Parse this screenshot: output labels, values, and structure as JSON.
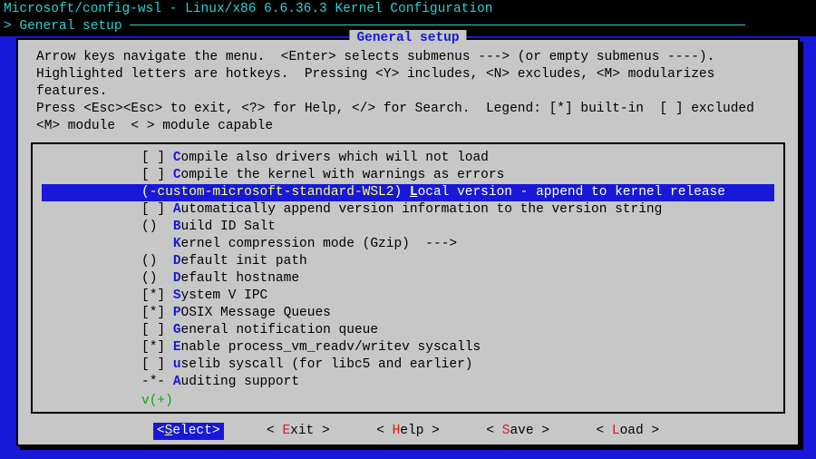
{
  "titlebar": "Microsoft/config-wsl - Linux/x86 6.6.36.3 Kernel Configuration",
  "breadcrumb": "> General setup ──────────────────────────────────────────────────────────────────────────────",
  "dialog_title": "General setup",
  "help": "Arrow keys navigate the menu.  <Enter> selects submenus ---> (or empty submenus ----).\nHighlighted letters are hotkeys.  Pressing <Y> includes, <N> excludes, <M> modularizes features.\nPress <Esc><Esc> to exit, <?> for Help, </> for Search.  Legend: [*] built-in  [ ] excluded\n<M> module  < > module capable",
  "items": [
    {
      "mark": "[ ]",
      "hk": "C",
      "label_rest": "ompile also drivers which will not load",
      "selected": false,
      "magenta": false
    },
    {
      "mark_l": "[",
      "mark_inner": " ",
      "mark_r": "]",
      "hk": "C",
      "label_rest": "ompile the kernel with warnings as errors",
      "selected": false,
      "magenta": true
    },
    {
      "mark_l": "(",
      "mark_inner": "-custom-microsoft-standard-WSL2",
      "mark_r": ")",
      "hk": "L",
      "label_rest": "ocal version - append to kernel release",
      "selected": true,
      "magenta": true
    },
    {
      "mark_l": "[",
      "mark_inner": " ",
      "mark_r": "]",
      "hk": "A",
      "label_rest": "utomatically append version information to the version string",
      "selected": false,
      "magenta": true
    },
    {
      "mark": "() ",
      "hk": "B",
      "label_rest": "uild ID Salt",
      "selected": false,
      "magenta": false
    },
    {
      "mark": "   ",
      "hk": "K",
      "label_rest": "ernel compression mode (Gzip)  --->",
      "selected": false,
      "magenta": false
    },
    {
      "mark": "() ",
      "hk": "D",
      "label_rest": "efault init path",
      "selected": false,
      "magenta": false
    },
    {
      "mark": "() ",
      "hk": "D",
      "label_rest": "efault hostname",
      "selected": false,
      "magenta": false
    },
    {
      "mark": "[*]",
      "hk": "S",
      "label_rest": "ystem V IPC",
      "selected": false,
      "magenta": false
    },
    {
      "mark": "[*]",
      "hk": "P",
      "label_rest": "OSIX Message Queues",
      "selected": false,
      "magenta": false
    },
    {
      "mark": "[ ]",
      "hk": "G",
      "label_rest": "eneral notification queue",
      "selected": false,
      "magenta": false
    },
    {
      "mark": "[*]",
      "hk": "E",
      "label_rest": "nable process_vm_readv/writev syscalls",
      "selected": false,
      "magenta": false
    },
    {
      "mark": "[ ]",
      "hk": "u",
      "label_rest": "selib syscall (for libc5 and earlier)",
      "selected": false,
      "magenta": false
    },
    {
      "mark": "-*-",
      "hk": "A",
      "label_rest": "uditing support",
      "selected": false,
      "magenta": false
    }
  ],
  "more_indicator": "v(+)",
  "buttons": [
    {
      "label_pre": "<",
      "hk": "S",
      "label_post": "elect>",
      "selected": true
    },
    {
      "label_pre": "< ",
      "hk": "E",
      "label_post": "xit >",
      "selected": false
    },
    {
      "label_pre": "< ",
      "hk": "H",
      "label_post": "elp >",
      "selected": false
    },
    {
      "label_pre": "< ",
      "hk": "S",
      "label_post": "ave >",
      "selected": false
    },
    {
      "label_pre": "< ",
      "hk": "L",
      "label_post": "oad >",
      "selected": false
    }
  ]
}
